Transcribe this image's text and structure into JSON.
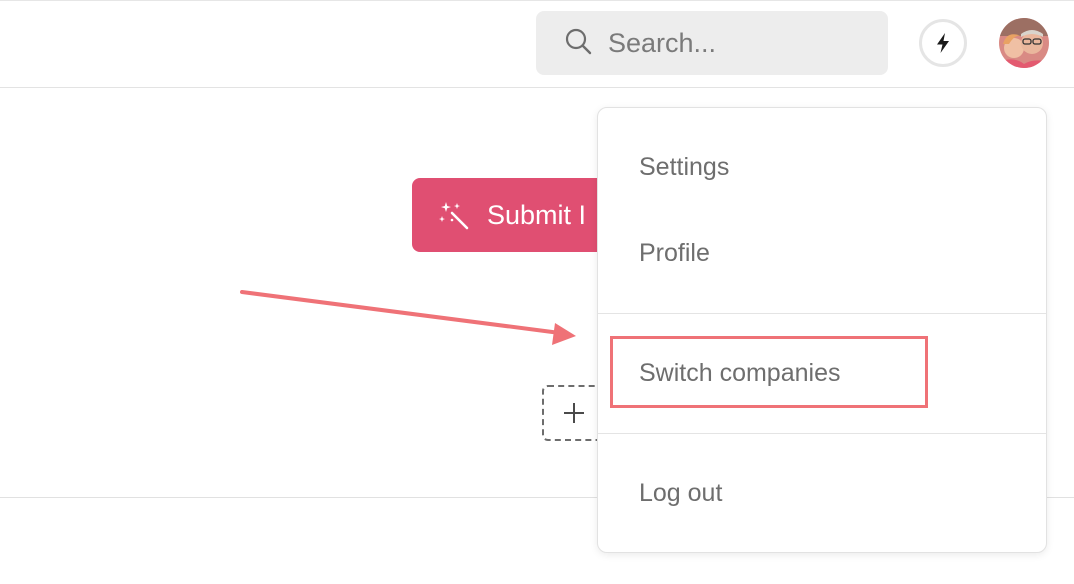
{
  "header": {
    "search": {
      "placeholder": "Search...",
      "value": "",
      "icon": "search-icon"
    },
    "activity_icon": "lightning-bolt-icon",
    "avatar_icon": "user-avatar"
  },
  "main": {
    "submit_button": {
      "label": "Submit I",
      "icon": "magic-wand-icon"
    },
    "add_button": {
      "icon": "plus-icon"
    }
  },
  "user_menu": {
    "items": [
      {
        "label": "Settings"
      },
      {
        "label": "Profile"
      },
      {
        "label": "Switch companies",
        "highlighted": true
      },
      {
        "label": "Log out"
      }
    ]
  },
  "colors": {
    "brand": "#e04f72",
    "annotation": "#ef7277",
    "search_bg": "#ededed",
    "menu_text": "#6e6e6e"
  }
}
